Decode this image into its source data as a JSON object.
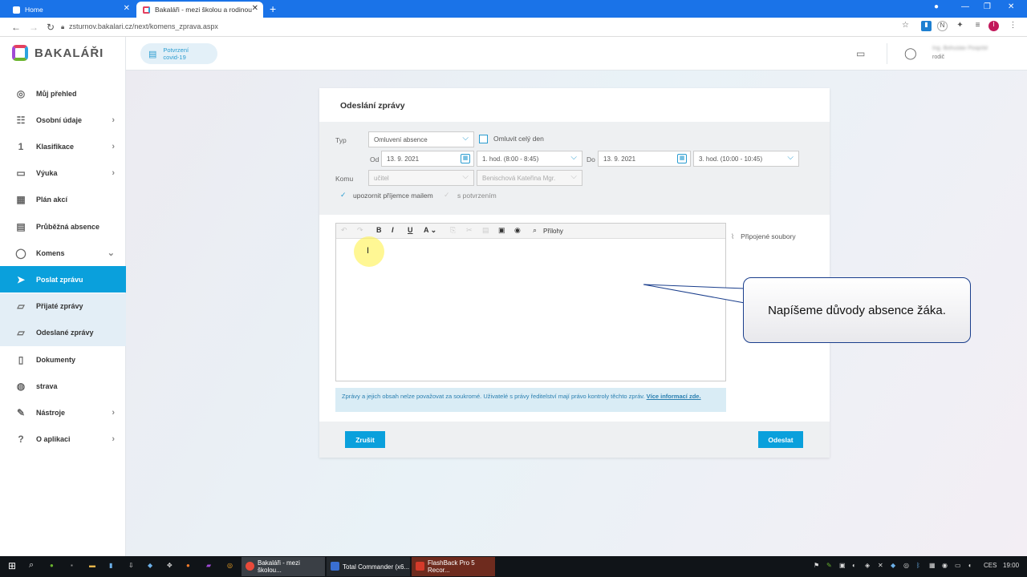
{
  "browser": {
    "tabs": [
      {
        "label": "Home"
      },
      {
        "label": "Bakaláři - mezi školou a rodinou"
      }
    ],
    "url": "zsturnov.bakalari.cz/next/komens_zprava.aspx"
  },
  "app": {
    "logo": "BAKALÁŘI",
    "covid_badge": [
      "Potvrzení",
      "covid-19"
    ],
    "user_role": "rodič",
    "user_name": "Ing. Bohuslav Pospíšil"
  },
  "sidebar": {
    "items": [
      {
        "label": "Můj přehled",
        "icon": "overview-icon"
      },
      {
        "label": "Osobní údaje",
        "icon": "person-card-icon",
        "chevron": true
      },
      {
        "label": "Klasifikace",
        "icon": "grade-icon",
        "chevron": true
      },
      {
        "label": "Výuka",
        "icon": "book-icon",
        "chevron": true
      },
      {
        "label": "Plán akcí",
        "icon": "calendar-icon"
      },
      {
        "label": "Průběžná absence",
        "icon": "absence-icon"
      },
      {
        "label": "Komens",
        "icon": "chat-icon",
        "chevron": true
      },
      {
        "label": "Poslat zprávu",
        "icon": "send-icon",
        "active": true
      },
      {
        "label": "Přijaté zprávy",
        "icon": "inbox-icon",
        "sub": true
      },
      {
        "label": "Odeslané zprávy",
        "icon": "sent-icon",
        "sub": true
      },
      {
        "label": "Dokumenty",
        "icon": "document-icon"
      },
      {
        "label": "strava",
        "icon": "food-icon"
      },
      {
        "label": "Nástroje",
        "icon": "tools-icon",
        "chevron": true
      },
      {
        "label": "O aplikaci",
        "icon": "info-icon",
        "chevron": true
      }
    ]
  },
  "dialog": {
    "title": "Odeslání zprávy",
    "typ_label": "Typ",
    "typ_value": "Omluvení absence",
    "omluvit_label": "Omluvit celý den",
    "od_label": "Od",
    "od_date": "13. 9. 2021",
    "od_hour": "1. hod. (8:00 - 8:45)",
    "do_label": "Do",
    "do_date": "13. 9. 2021",
    "do_hour": "3. hod. (10:00 - 10:45)",
    "komu_label": "Komu",
    "komu_role": "učitel",
    "komu_person": "Benischová Kateřina Mgr.",
    "notify_label": "upozornit příjemce mailem",
    "confirm_label": "s potvrzením",
    "toolbar_attach": "Přílohy",
    "attached_files": "Připojené soubory",
    "notice_text": "Zprávy a jejich obsah nelze považovat za soukromé. Uživatelé s právy ředitelství mají právo kontroly těchto zpráv.",
    "notice_link": "Více informací zde.",
    "cancel_label": "Zrušit",
    "send_label": "Odeslat"
  },
  "callout": {
    "text": "Napíšeme důvody absence žáka."
  },
  "taskbar": {
    "apps": [
      {
        "label": "Bakaláři - mezi školou..."
      },
      {
        "label": "Total Commander (x6..."
      },
      {
        "label": "FlashBack Pro 5 Recor..."
      }
    ],
    "lang": "CES",
    "time": "19:00"
  }
}
